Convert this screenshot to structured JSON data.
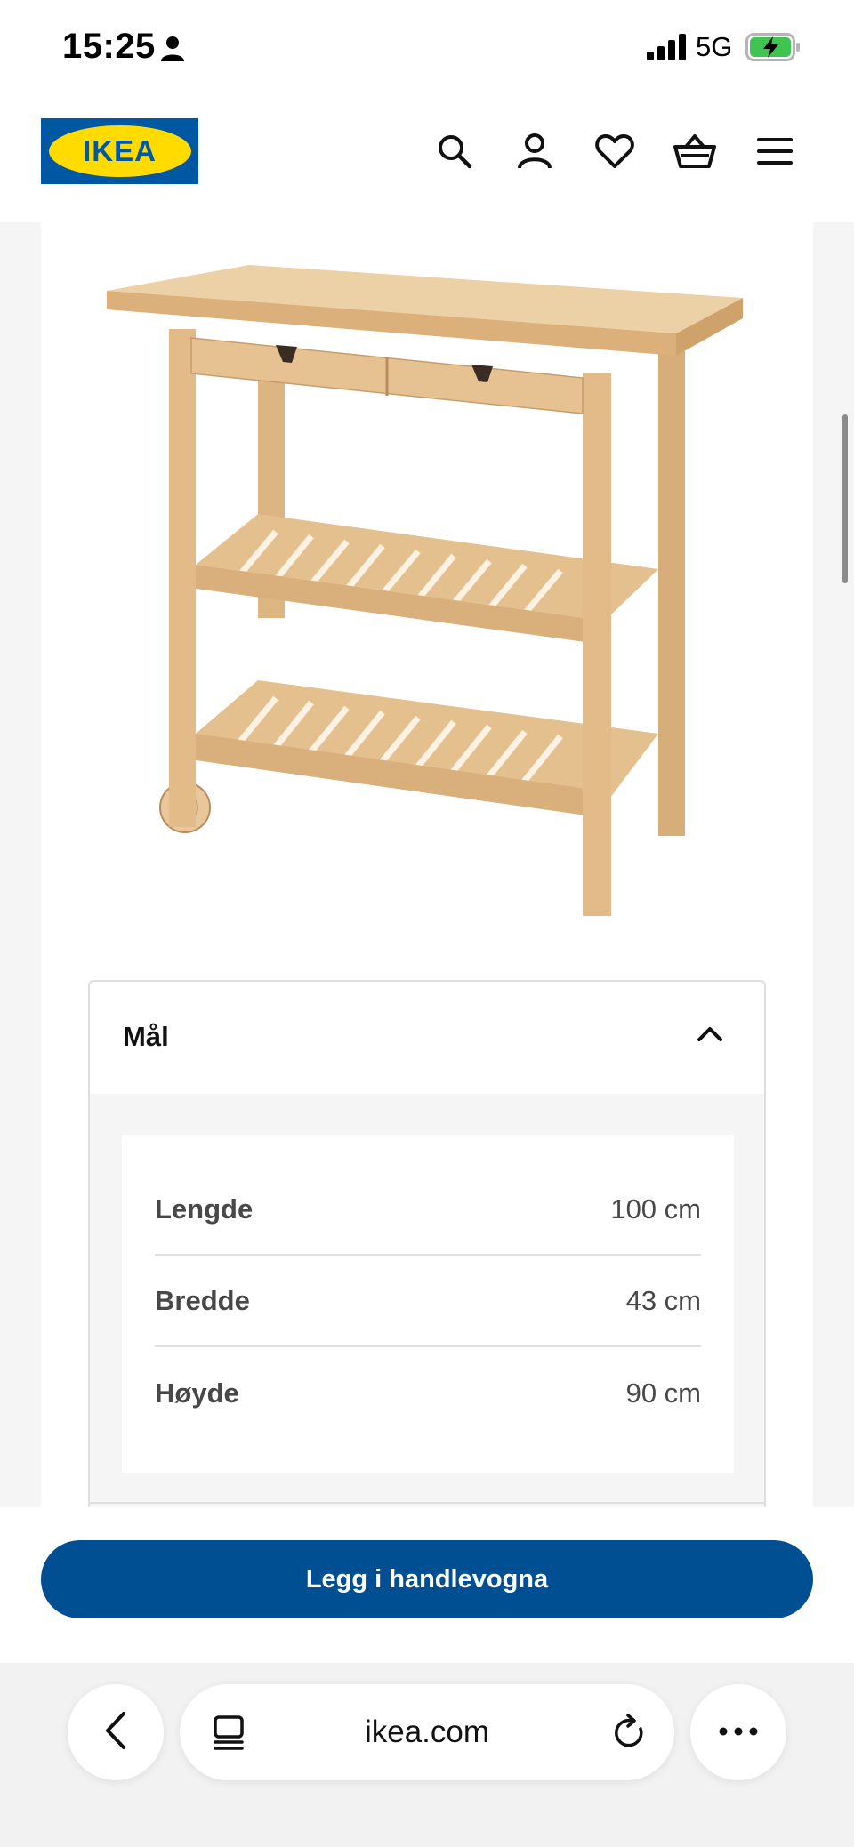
{
  "status_bar": {
    "time": "15:25",
    "network": "5G",
    "person_icon": "person-icon",
    "signal_icon": "signal-bars-icon",
    "battery_icon": "battery-charging-icon"
  },
  "header": {
    "logo_text": "IKEA",
    "logo_colors": {
      "background": "#0058a3",
      "oval": "#ffdb00"
    },
    "icons": [
      "search-icon",
      "account-icon",
      "heart-icon",
      "basket-icon",
      "menu-icon"
    ]
  },
  "product": {
    "image": "wooden-kitchen-trolley"
  },
  "dimensions": {
    "title": "Mål",
    "rows": [
      {
        "label": "Lengde",
        "value": "100 cm"
      },
      {
        "label": "Bredde",
        "value": "43 cm"
      },
      {
        "label": "Høyde",
        "value": "90 cm"
      }
    ]
  },
  "cta": {
    "label": "Legg i handlevogna",
    "color": "#004f93"
  },
  "browser": {
    "url": "ikea.com",
    "icons": [
      "back-icon",
      "tabs-icon",
      "reload-icon",
      "more-icon"
    ]
  }
}
